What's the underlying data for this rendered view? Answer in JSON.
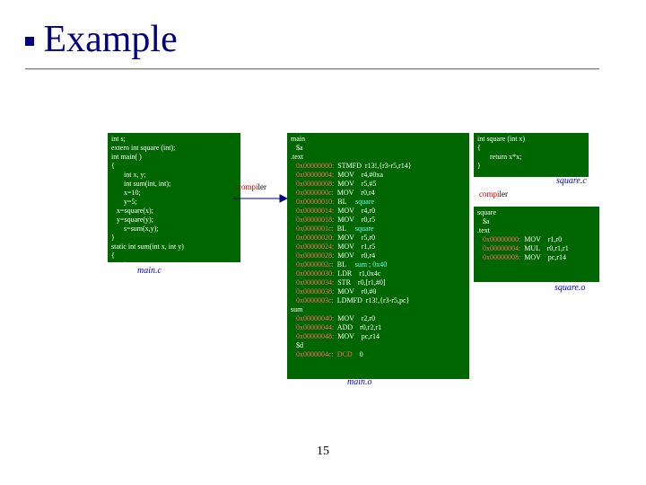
{
  "title": "Example",
  "labels": {
    "compiler1": "compiler",
    "compiler2": "compiler",
    "mainc": "main.c",
    "squarec": "square.c",
    "squareo": "square.o",
    "maino": "main.o"
  },
  "box1_code": "int s;\nextern int square (int);\nint main( )\n{\n       int x, y;\n       int sum(int, int);\n       x=10;\n       y=5;\n   x=square(x);\n   y=square(y);\n       s=sum(x,y);\n}\nstatic int sum(int x, int y)\n{\n       int u;\n       u=x+y;\n       return u;\n}",
  "box2_lines": [
    {
      "t": "main"
    },
    {
      "t": "   $a"
    },
    {
      "t": ".text"
    },
    {
      "a": "0x00000000:",
      "o": "STMFD",
      "r": "r13!,{r3-r5,r14}"
    },
    {
      "a": "0x00000004:",
      "o": "MOV",
      "r": "r4,#0xa"
    },
    {
      "a": "0x00000008:",
      "o": "MOV",
      "r": "r5,#5"
    },
    {
      "a": "0x0000000c:",
      "o": "MOV",
      "r": "r0,r4"
    },
    {
      "a": "0x00000010:",
      "o": "BL",
      "r": "square",
      "hl": true
    },
    {
      "a": "0x00000014:",
      "o": "MOV",
      "r": "r4,r0"
    },
    {
      "a": "0x00000018:",
      "o": "MOV",
      "r": "r0,r5"
    },
    {
      "a": "0x0000001c:",
      "o": "BL",
      "r": "square",
      "hl": true
    },
    {
      "a": "0x00000020:",
      "o": "MOV",
      "r": "r5,r0"
    },
    {
      "a": "0x00000024:",
      "o": "MOV",
      "r": "r1,r5"
    },
    {
      "a": "0x00000028:",
      "o": "MOV",
      "r": "r0,r4"
    },
    {
      "a": "0x0000002c:",
      "o": "BL",
      "r": "sum ; 0x40",
      "hl": true
    },
    {
      "a": "0x00000030:",
      "o": "LDR",
      "r": "r1,0x4c"
    },
    {
      "a": "0x00000034:",
      "o": "STR",
      "r": "r0,[r1,#0]"
    },
    {
      "a": "0x00000038:",
      "o": "MOV",
      "r": "r0,#0"
    },
    {
      "a": "0x0000003c:",
      "o": "LDMFD",
      "r": "r13!,{r3-r5,pc}"
    },
    {
      "t": "sum"
    },
    {
      "a": "0x00000040:",
      "o": "MOV",
      "r": "r2,r0"
    },
    {
      "a": "0x00000044:",
      "o": "ADD",
      "r": "r0,r2,r1"
    },
    {
      "a": "0x00000048:",
      "o": "MOV",
      "r": "pc,r14"
    },
    {
      "t": "   $d"
    },
    {
      "a": "0x0000004c:",
      "o": "DCD",
      "r": "0",
      "dcd": true
    }
  ],
  "box3_code": "int square (int x)\n{\n       return x*x;\n}",
  "box4_lines": [
    {
      "t": "square"
    },
    {
      "t": "   $a"
    },
    {
      "t": ".text"
    },
    {
      "a": "0x00000000:",
      "o": "MOV",
      "r": "r1,r0"
    },
    {
      "a": "0x00000004:",
      "o": "MUL",
      "r": "r0,r1,r1"
    },
    {
      "a": "0x00000008:",
      "o": "MOV",
      "r": "pc,r14"
    }
  ],
  "page_number": "15"
}
